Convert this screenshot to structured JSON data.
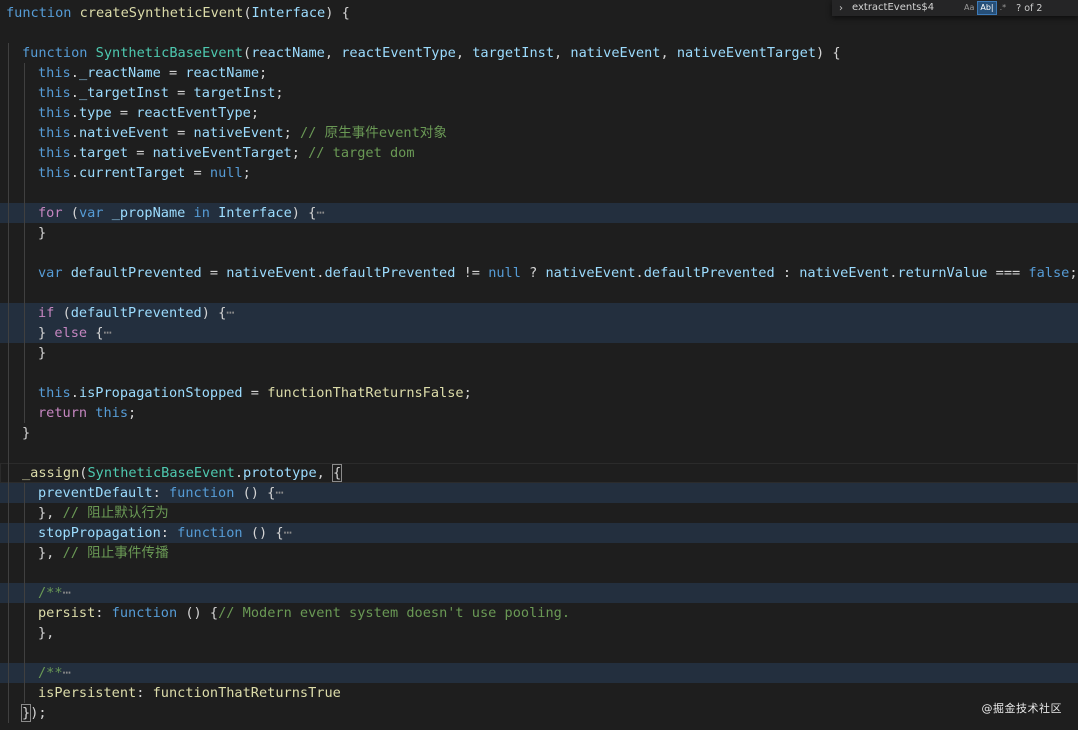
{
  "find_widget": {
    "query": "extractEvents$4",
    "match_case_label": "Aa",
    "whole_word_label": "Ab|",
    "regex_label": ".*",
    "match_count": "? of 2"
  },
  "watermark": "@掘金技术社区",
  "code": {
    "lines": [
      {
        "indent": 0,
        "tokens": [
          [
            "k",
            "function "
          ],
          [
            "f",
            "createSyntheticEvent"
          ],
          [
            "p",
            "("
          ],
          [
            "v",
            "Interface"
          ],
          [
            "p",
            ") {"
          ]
        ]
      },
      {
        "indent": 0,
        "tokens": []
      },
      {
        "indent": 1,
        "tokens": [
          [
            "k",
            "function "
          ],
          [
            "t",
            "SyntheticBaseEvent"
          ],
          [
            "p",
            "("
          ],
          [
            "v",
            "reactName"
          ],
          [
            "p",
            ", "
          ],
          [
            "v",
            "reactEventType"
          ],
          [
            "p",
            ", "
          ],
          [
            "v",
            "targetInst"
          ],
          [
            "p",
            ", "
          ],
          [
            "v",
            "nativeEvent"
          ],
          [
            "p",
            ", "
          ],
          [
            "v",
            "nativeEventTarget"
          ],
          [
            "p",
            ") {"
          ]
        ]
      },
      {
        "indent": 2,
        "tokens": [
          [
            "k",
            "this"
          ],
          [
            "p",
            "."
          ],
          [
            "v",
            "_reactName"
          ],
          [
            "p",
            " = "
          ],
          [
            "v",
            "reactName"
          ],
          [
            "p",
            ";"
          ]
        ]
      },
      {
        "indent": 2,
        "tokens": [
          [
            "k",
            "this"
          ],
          [
            "p",
            "."
          ],
          [
            "v",
            "_targetInst"
          ],
          [
            "p",
            " = "
          ],
          [
            "v",
            "targetInst"
          ],
          [
            "p",
            ";"
          ]
        ]
      },
      {
        "indent": 2,
        "tokens": [
          [
            "k",
            "this"
          ],
          [
            "p",
            "."
          ],
          [
            "v",
            "type"
          ],
          [
            "p",
            " = "
          ],
          [
            "v",
            "reactEventType"
          ],
          [
            "p",
            ";"
          ]
        ]
      },
      {
        "indent": 2,
        "tokens": [
          [
            "k",
            "this"
          ],
          [
            "p",
            "."
          ],
          [
            "v",
            "nativeEvent"
          ],
          [
            "p",
            " = "
          ],
          [
            "v",
            "nativeEvent"
          ],
          [
            "p",
            "; "
          ],
          [
            "cm",
            "// 原生事件event对象"
          ]
        ]
      },
      {
        "indent": 2,
        "tokens": [
          [
            "k",
            "this"
          ],
          [
            "p",
            "."
          ],
          [
            "v",
            "target"
          ],
          [
            "p",
            " = "
          ],
          [
            "v",
            "nativeEventTarget"
          ],
          [
            "p",
            "; "
          ],
          [
            "cm",
            "// target dom"
          ]
        ]
      },
      {
        "indent": 2,
        "tokens": [
          [
            "k",
            "this"
          ],
          [
            "p",
            "."
          ],
          [
            "v",
            "currentTarget"
          ],
          [
            "p",
            " = "
          ],
          [
            "k",
            "null"
          ],
          [
            "p",
            ";"
          ]
        ]
      },
      {
        "indent": 2,
        "tokens": []
      },
      {
        "indent": 2,
        "hl": true,
        "tokens": [
          [
            "c",
            "for "
          ],
          [
            "p",
            "("
          ],
          [
            "k",
            "var "
          ],
          [
            "v",
            "_propName "
          ],
          [
            "k",
            "in "
          ],
          [
            "v",
            "Interface"
          ],
          [
            "p",
            ") {"
          ],
          [
            "ell",
            "⋯"
          ]
        ]
      },
      {
        "indent": 2,
        "tokens": [
          [
            "p",
            "}"
          ]
        ]
      },
      {
        "indent": 2,
        "tokens": []
      },
      {
        "indent": 2,
        "tokens": [
          [
            "k",
            "var "
          ],
          [
            "v",
            "defaultPrevented"
          ],
          [
            "p",
            " = "
          ],
          [
            "v",
            "nativeEvent"
          ],
          [
            "p",
            "."
          ],
          [
            "v",
            "defaultPrevented"
          ],
          [
            "p",
            " != "
          ],
          [
            "k",
            "null"
          ],
          [
            "p",
            " ? "
          ],
          [
            "v",
            "nativeEvent"
          ],
          [
            "p",
            "."
          ],
          [
            "v",
            "defaultPrevented"
          ],
          [
            "p",
            " : "
          ],
          [
            "v",
            "nativeEvent"
          ],
          [
            "p",
            "."
          ],
          [
            "v",
            "returnValue"
          ],
          [
            "p",
            " === "
          ],
          [
            "k",
            "false"
          ],
          [
            "p",
            ";"
          ]
        ]
      },
      {
        "indent": 2,
        "tokens": []
      },
      {
        "indent": 2,
        "hl": true,
        "tokens": [
          [
            "c",
            "if "
          ],
          [
            "p",
            "("
          ],
          [
            "v",
            "defaultPrevented"
          ],
          [
            "p",
            ") {"
          ],
          [
            "ell",
            "⋯"
          ]
        ]
      },
      {
        "indent": 2,
        "hl": true,
        "tokens": [
          [
            "p",
            "} "
          ],
          [
            "c",
            "else "
          ],
          [
            "p",
            "{"
          ],
          [
            "ell",
            "⋯"
          ]
        ]
      },
      {
        "indent": 2,
        "tokens": [
          [
            "p",
            "}"
          ]
        ]
      },
      {
        "indent": 2,
        "tokens": []
      },
      {
        "indent": 2,
        "tokens": [
          [
            "k",
            "this"
          ],
          [
            "p",
            "."
          ],
          [
            "v",
            "isPropagationStopped"
          ],
          [
            "p",
            " = "
          ],
          [
            "f",
            "functionThatReturnsFalse"
          ],
          [
            "p",
            ";"
          ]
        ]
      },
      {
        "indent": 2,
        "tokens": [
          [
            "c",
            "return "
          ],
          [
            "k",
            "this"
          ],
          [
            "p",
            ";"
          ]
        ]
      },
      {
        "indent": 1,
        "tokens": [
          [
            "p",
            "}"
          ]
        ]
      },
      {
        "indent": 1,
        "tokens": []
      },
      {
        "indent": 1,
        "cur": true,
        "tokens": [
          [
            "f",
            "_assign"
          ],
          [
            "p",
            "("
          ],
          [
            "t",
            "SyntheticBaseEvent"
          ],
          [
            "p",
            "."
          ],
          [
            "v",
            "prototype"
          ],
          [
            "p",
            ", "
          ],
          [
            "brk",
            "{"
          ]
        ]
      },
      {
        "indent": 2,
        "hl": true,
        "tokens": [
          [
            "v",
            "preventDefault"
          ],
          [
            "p",
            ": "
          ],
          [
            "k",
            "function "
          ],
          [
            "p",
            "() {"
          ],
          [
            "ell",
            "⋯"
          ]
        ]
      },
      {
        "indent": 2,
        "tokens": [
          [
            "p",
            "}, "
          ],
          [
            "cm",
            "// 阻止默认行为"
          ]
        ]
      },
      {
        "indent": 2,
        "hl": true,
        "tokens": [
          [
            "v",
            "stopPropagation"
          ],
          [
            "p",
            ": "
          ],
          [
            "k",
            "function "
          ],
          [
            "p",
            "() {"
          ],
          [
            "ell",
            "⋯"
          ]
        ]
      },
      {
        "indent": 2,
        "tokens": [
          [
            "p",
            "}, "
          ],
          [
            "cm",
            "// 阻止事件传播"
          ]
        ]
      },
      {
        "indent": 2,
        "tokens": []
      },
      {
        "indent": 2,
        "hl": true,
        "tokens": [
          [
            "cm",
            "/**"
          ],
          [
            "ell",
            "⋯"
          ]
        ]
      },
      {
        "indent": 2,
        "tokens": [
          [
            "f",
            "persist"
          ],
          [
            "p",
            ": "
          ],
          [
            "k",
            "function "
          ],
          [
            "p",
            "() {"
          ],
          [
            "cm",
            "// Modern event system doesn't use pooling."
          ]
        ]
      },
      {
        "indent": 2,
        "tokens": [
          [
            "p",
            "},"
          ]
        ]
      },
      {
        "indent": 2,
        "tokens": []
      },
      {
        "indent": 2,
        "hl": true,
        "tokens": [
          [
            "cm",
            "/**"
          ],
          [
            "ell",
            "⋯"
          ]
        ]
      },
      {
        "indent": 2,
        "tokens": [
          [
            "f",
            "isPersistent"
          ],
          [
            "p",
            ": "
          ],
          [
            "f",
            "functionThatReturnsTrue"
          ]
        ]
      },
      {
        "indent": 1,
        "tokens": [
          [
            "brk",
            "}"
          ],
          [
            "p",
            ");"
          ]
        ]
      }
    ]
  }
}
